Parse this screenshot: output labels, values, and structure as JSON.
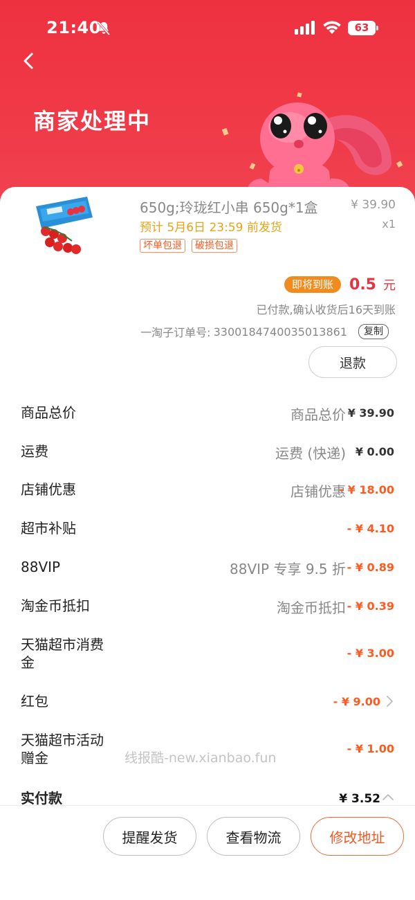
{
  "status_bar": {
    "time": "21:40",
    "battery": "63"
  },
  "header": {
    "title": "商家处理中"
  },
  "product": {
    "name": "650g;玲珑红小串 650g*1盒",
    "price": "¥ 39.90",
    "quantity": "x1",
    "ship_note": "预计 5月6日 23:59 前发货",
    "tags": [
      "坏单包退",
      "破损包退"
    ]
  },
  "payout": {
    "badge": "即将到账",
    "amount": "0.5",
    "unit": "元",
    "note": "已付款,确认收货后16天到账"
  },
  "order": {
    "label": "一淘子订单号:",
    "number": "3300184740035013861",
    "copy_label": "复制"
  },
  "refund_label": "退款",
  "price_rows": [
    {
      "label": "商品总价",
      "note": "商品总价",
      "amount": "¥ 39.90",
      "discount": false
    },
    {
      "label": "运费",
      "note": "运费 (快递)",
      "amount": "¥ 0.00",
      "discount": false
    },
    {
      "label": "店铺优惠",
      "note": "店铺优惠",
      "amount": "- ¥ 18.00",
      "discount": true
    },
    {
      "label": "超市补贴",
      "note": "",
      "amount": "- ¥ 4.10",
      "discount": true
    },
    {
      "label": "88VIP",
      "note": "88VIP 专享 9.5 折",
      "amount": "- ¥ 0.89",
      "discount": true
    },
    {
      "label": "淘金币抵扣",
      "note": "淘金币抵扣",
      "amount": "- ¥ 0.39",
      "discount": true
    },
    {
      "label": "天猫超市消费\n金",
      "note": "",
      "amount": "- ¥ 3.00",
      "discount": true
    },
    {
      "label": "红包",
      "note": "",
      "amount": "- ¥ 9.00",
      "discount": true
    },
    {
      "label": "天猫超市活动\n赠金",
      "note": "",
      "amount": "- ¥ 1.00",
      "discount": true
    },
    {
      "label": "实付款",
      "note": "",
      "amount": "¥ 3.52",
      "discount": false
    }
  ],
  "watermark": "线报酷-new.xianbao.fun",
  "bottom_buttons": [
    "提醒发货",
    "查看物流",
    "修改地址"
  ],
  "colors": {
    "header_red": "#ee3140",
    "accent_orange": "#f05a25",
    "discount": "#ff5a1f",
    "ship_note": "#e8a317"
  }
}
